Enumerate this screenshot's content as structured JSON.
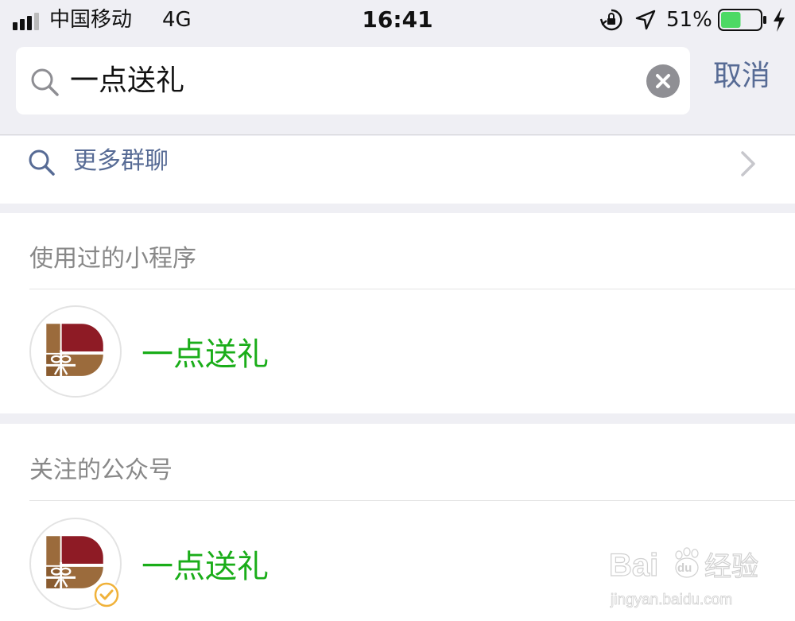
{
  "status_bar": {
    "carrier": "中国移动",
    "network": "4G",
    "time": "16:41",
    "battery_percent": "51%",
    "battery_level": 0.51,
    "icons": [
      "signal-bars-icon",
      "rotation-lock-icon",
      "location-arrow-icon",
      "battery-icon",
      "charging-bolt-icon"
    ]
  },
  "search": {
    "value": "一点送礼",
    "cancel_label": "取消",
    "icons": [
      "search-icon",
      "clear-icon"
    ]
  },
  "more_groups": {
    "label": "更多群聊",
    "icons": [
      "search-icon",
      "chevron-right-icon"
    ]
  },
  "sections": {
    "mini_programs": {
      "title": "使用过的小程序",
      "items": [
        {
          "name": "一点送礼",
          "icon": "gift-logo-icon"
        }
      ]
    },
    "official_accounts": {
      "title": "关注的公众号",
      "items": [
        {
          "name": "一点送礼",
          "icon": "gift-logo-icon",
          "verified": true
        }
      ]
    }
  },
  "watermark": {
    "brand_prefix": "Bai",
    "brand_suffix": "经验",
    "url": "jingyan.baidu.com"
  },
  "colors": {
    "background": "#efeff4",
    "link": "#576b95",
    "highlight": "#1aad19",
    "logo_brown": "#9b6b3c",
    "logo_red": "#8e1b25",
    "battery_green": "#4cd964",
    "badge_gold": "#f0b23a"
  }
}
